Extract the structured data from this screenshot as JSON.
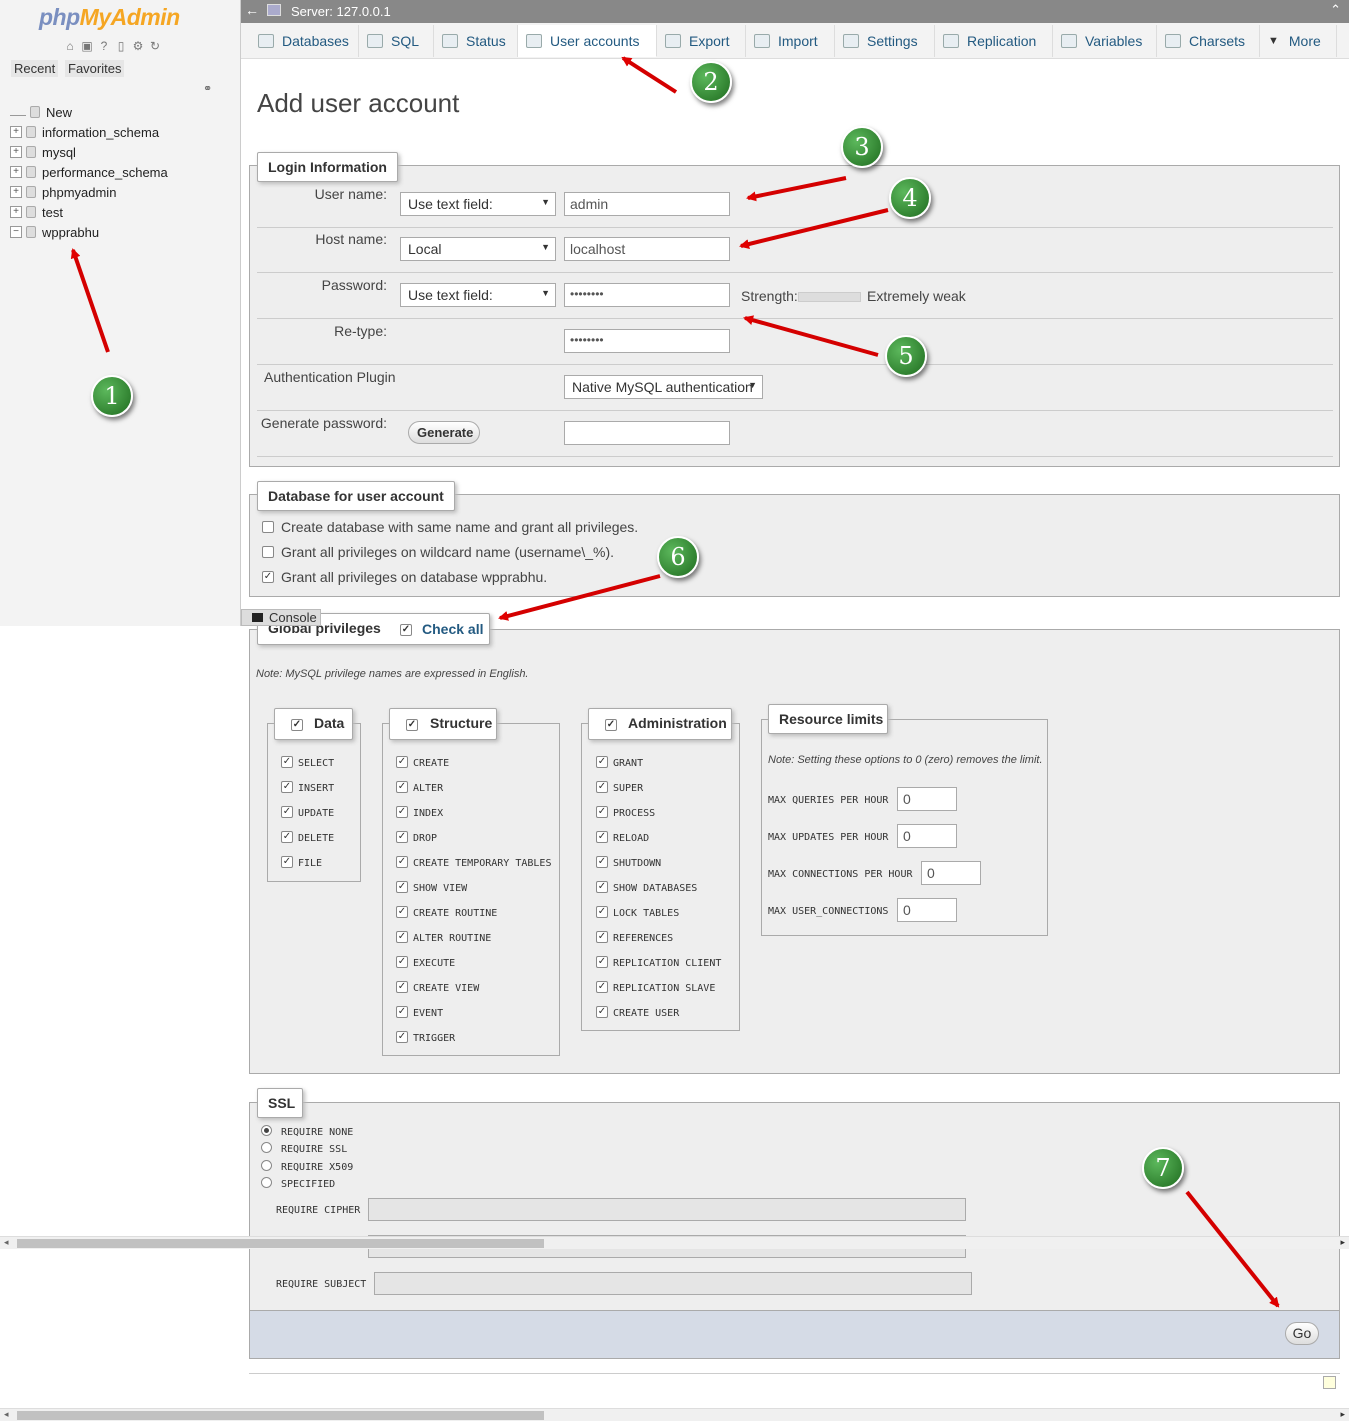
{
  "sidebar": {
    "logo_php": "php",
    "logo_rest": "MyAdmin",
    "tab_recent": "Recent",
    "tab_favorites": "Favorites",
    "tree": [
      {
        "label": "New"
      },
      {
        "label": "information_schema"
      },
      {
        "label": "mysql"
      },
      {
        "label": "performance_schema"
      },
      {
        "label": "phpmyadmin"
      },
      {
        "label": "test"
      },
      {
        "label": "wpprabhu"
      }
    ]
  },
  "topbar": {
    "server": "Server: 127.0.0.1"
  },
  "tabs": [
    {
      "label": "Databases"
    },
    {
      "label": "SQL"
    },
    {
      "label": "Status"
    },
    {
      "label": "User accounts"
    },
    {
      "label": "Export"
    },
    {
      "label": "Import"
    },
    {
      "label": "Settings"
    },
    {
      "label": "Replication"
    },
    {
      "label": "Variables"
    },
    {
      "label": "Charsets"
    },
    {
      "label": "More"
    }
  ],
  "page_title": "Add user account",
  "login": {
    "legend": "Login Information",
    "user_label": "User name:",
    "user_select": "Use text field:",
    "user_value": "admin",
    "host_label": "Host name:",
    "host_select": "Local",
    "host_value": "localhost",
    "password_label": "Password:",
    "password_select": "Use text field:",
    "password_value": "••••••••",
    "strength_label": "Strength:",
    "strength_value": "Extremely weak",
    "retype_label": "Re-type:",
    "retype_value": "••••••••",
    "auth_label": "Authentication Plugin",
    "auth_select": "Native MySQL authentication",
    "generate_label": "Generate password:",
    "generate_button": "Generate"
  },
  "database": {
    "legend": "Database for user account",
    "options": [
      {
        "label": "Create database with same name and grant all privileges.",
        "checked": false
      },
      {
        "label": "Grant all privileges on wildcard name (username\\_%).",
        "checked": false
      },
      {
        "label": "Grant all privileges on database wpprabhu.",
        "checked": true
      }
    ]
  },
  "console_label": "Console",
  "global": {
    "legend": "Global privileges",
    "check_all": "Check all",
    "note": "Note: MySQL privilege names are expressed in English.",
    "data": {
      "legend": "Data",
      "items": [
        "SELECT",
        "INSERT",
        "UPDATE",
        "DELETE",
        "FILE"
      ]
    },
    "structure": {
      "legend": "Structure",
      "items": [
        "CREATE",
        "ALTER",
        "INDEX",
        "DROP",
        "CREATE TEMPORARY TABLES",
        "SHOW VIEW",
        "CREATE ROUTINE",
        "ALTER ROUTINE",
        "EXECUTE",
        "CREATE VIEW",
        "EVENT",
        "TRIGGER"
      ]
    },
    "administration": {
      "legend": "Administration",
      "items": [
        "GRANT",
        "SUPER",
        "PROCESS",
        "RELOAD",
        "SHUTDOWN",
        "SHOW DATABASES",
        "LOCK TABLES",
        "REFERENCES",
        "REPLICATION CLIENT",
        "REPLICATION SLAVE",
        "CREATE USER"
      ]
    },
    "resources": {
      "legend": "Resource limits",
      "note": "Note: Setting these options to 0 (zero) removes the limit.",
      "items": [
        {
          "label": "MAX QUERIES PER HOUR",
          "value": "0"
        },
        {
          "label": "MAX UPDATES PER HOUR",
          "value": "0"
        },
        {
          "label": "MAX CONNECTIONS PER HOUR",
          "value": "0"
        },
        {
          "label": "MAX USER_CONNECTIONS",
          "value": "0"
        }
      ]
    }
  },
  "ssl": {
    "legend": "SSL",
    "options": [
      {
        "label": "REQUIRE NONE",
        "selected": true
      },
      {
        "label": "REQUIRE SSL",
        "selected": false
      },
      {
        "label": "REQUIRE X509",
        "selected": false
      },
      {
        "label": "SPECIFIED",
        "selected": false
      }
    ],
    "cipher_label": "REQUIRE CIPHER",
    "subject_label": "REQUIRE SUBJECT"
  },
  "go_button": "Go",
  "markers": [
    "1",
    "2",
    "3",
    "4",
    "5",
    "6",
    "7"
  ],
  "colors": {
    "accent": "#235a81",
    "arrow": "#e00000",
    "marker": "#2e8b2e"
  }
}
